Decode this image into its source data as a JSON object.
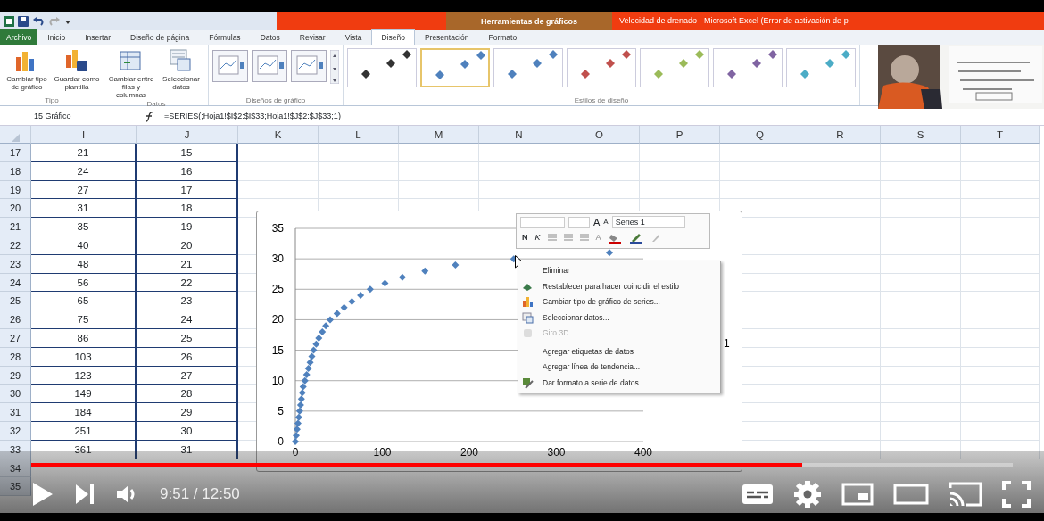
{
  "title_bar": {
    "contextual_group": "Herramientas de gráficos",
    "title": "Velocidad de drenado  -  Microsoft Excel (Error de activación de p"
  },
  "ribbon_tabs": [
    {
      "label": "Archivo",
      "kind": "file",
      "selected": false
    },
    {
      "label": "Inicio",
      "kind": "tab",
      "selected": false
    },
    {
      "label": "Insertar",
      "kind": "tab",
      "selected": false
    },
    {
      "label": "Diseño de página",
      "kind": "tab",
      "selected": false
    },
    {
      "label": "Fórmulas",
      "kind": "tab",
      "selected": false
    },
    {
      "label": "Datos",
      "kind": "tab",
      "selected": false
    },
    {
      "label": "Revisar",
      "kind": "tab",
      "selected": false
    },
    {
      "label": "Vista",
      "kind": "tab",
      "selected": false
    },
    {
      "label": "Diseño",
      "kind": "tab",
      "selected": true
    },
    {
      "label": "Presentación",
      "kind": "tab",
      "selected": false
    },
    {
      "label": "Formato",
      "kind": "tab",
      "selected": false
    }
  ],
  "ribbon_groups": [
    {
      "label": "Tipo",
      "kind": "buttons",
      "buttons": [
        "Cambiar tipo de gráfico",
        "Guardar como plantilla"
      ]
    },
    {
      "label": "Datos",
      "kind": "buttons",
      "buttons": [
        "Cambiar entre filas y columnas",
        "Seleccionar datos"
      ]
    },
    {
      "label": "Diseños de gráfico",
      "kind": "layouts"
    },
    {
      "label": "Estilos de diseño",
      "kind": "styles",
      "styles": [
        {
          "color": "#333333",
          "selected": false
        },
        {
          "color": "#4f81bd",
          "selected": true
        },
        {
          "color": "#4f81bd",
          "selected": false
        },
        {
          "color": "#c0504d",
          "selected": false
        },
        {
          "color": "#9bbb59",
          "selected": false
        },
        {
          "color": "#8064a2",
          "selected": false
        },
        {
          "color": "#4bacc6",
          "selected": false
        }
      ]
    }
  ],
  "formula_bar": {
    "name_box": "15 Gráfico",
    "formula": "=SERIES(;Hoja1!$I$2:$I$33;Hoja1!$J$2:$J$33;1)"
  },
  "sheet": {
    "columns": [
      "I",
      "J",
      "K",
      "L",
      "M",
      "N",
      "O",
      "P",
      "Q",
      "R",
      "S",
      "T"
    ],
    "rows": [
      {
        "number": "17",
        "cells": [
          "21",
          "15"
        ]
      },
      {
        "number": "18",
        "cells": [
          "24",
          "16"
        ]
      },
      {
        "number": "19",
        "cells": [
          "27",
          "17"
        ]
      },
      {
        "number": "20",
        "cells": [
          "31",
          "18"
        ]
      },
      {
        "number": "21",
        "cells": [
          "35",
          "19"
        ]
      },
      {
        "number": "22",
        "cells": [
          "40",
          "20"
        ]
      },
      {
        "number": "23",
        "cells": [
          "48",
          "21"
        ]
      },
      {
        "number": "24",
        "cells": [
          "56",
          "22"
        ]
      },
      {
        "number": "25",
        "cells": [
          "65",
          "23"
        ]
      },
      {
        "number": "26",
        "cells": [
          "75",
          "24"
        ]
      },
      {
        "number": "27",
        "cells": [
          "86",
          "25"
        ]
      },
      {
        "number": "28",
        "cells": [
          "103",
          "26"
        ]
      },
      {
        "number": "29",
        "cells": [
          "123",
          "27"
        ]
      },
      {
        "number": "30",
        "cells": [
          "149",
          "28"
        ]
      },
      {
        "number": "31",
        "cells": [
          "184",
          "29"
        ]
      },
      {
        "number": "32",
        "cells": [
          "251",
          "30"
        ]
      },
      {
        "number": "33",
        "cells": [
          "361",
          "31"
        ]
      },
      {
        "number": "34",
        "cells": []
      },
      {
        "number": "35",
        "cells": []
      }
    ]
  },
  "chart": {
    "legend_fragment": "1",
    "chart_data": {
      "type": "scatter",
      "x": [
        0,
        1,
        2,
        3,
        4,
        5,
        6,
        7,
        8,
        9,
        11,
        13,
        15,
        17,
        19,
        21,
        24,
        27,
        31,
        35,
        40,
        48,
        56,
        65,
        75,
        86,
        103,
        123,
        149,
        184,
        251,
        361
      ],
      "series": [
        {
          "name": "Series 1",
          "color": "#4f81bd",
          "values": [
            0,
            1,
            2,
            3,
            4,
            5,
            6,
            7,
            8,
            9,
            10,
            11,
            12,
            13,
            14,
            15,
            16,
            17,
            18,
            19,
            20,
            21,
            22,
            23,
            24,
            25,
            26,
            27,
            28,
            29,
            30,
            31
          ]
        }
      ],
      "xlim": [
        0,
        400
      ],
      "ylim": [
        0,
        35
      ],
      "grid": true,
      "xticks": [
        0,
        100,
        200,
        300,
        400
      ],
      "yticks": [
        0,
        5,
        10,
        15,
        20,
        25,
        30,
        35
      ]
    }
  },
  "mini_toolbar": {
    "grow": "A",
    "shrink": "A",
    "bold": "N",
    "italic": "K",
    "font_color": "A"
  },
  "context_menu": [
    {
      "label": "Eliminar",
      "icon": false,
      "disabled": false,
      "separator_before": false
    },
    {
      "label": "Restablecer para hacer coincidir el estilo",
      "icon": true,
      "disabled": false,
      "separator_before": false
    },
    {
      "label": "Cambiar tipo de gráfico de series...",
      "icon": true,
      "disabled": false,
      "separator_before": false
    },
    {
      "label": "Seleccionar datos...",
      "icon": true,
      "disabled": false,
      "separator_before": false
    },
    {
      "label": "Giro 3D...",
      "icon": true,
      "disabled": true,
      "separator_before": false
    },
    {
      "label": "Agregar etiquetas de datos",
      "icon": false,
      "disabled": false,
      "separator_before": true
    },
    {
      "label": "Agregar línea de tendencia...",
      "icon": false,
      "disabled": false,
      "separator_before": false
    },
    {
      "label": "Dar formato a serie de datos...",
      "icon": true,
      "disabled": false,
      "separator_before": false
    }
  ],
  "player": {
    "time": "9:51 / 12:50",
    "level": 0.785
  }
}
